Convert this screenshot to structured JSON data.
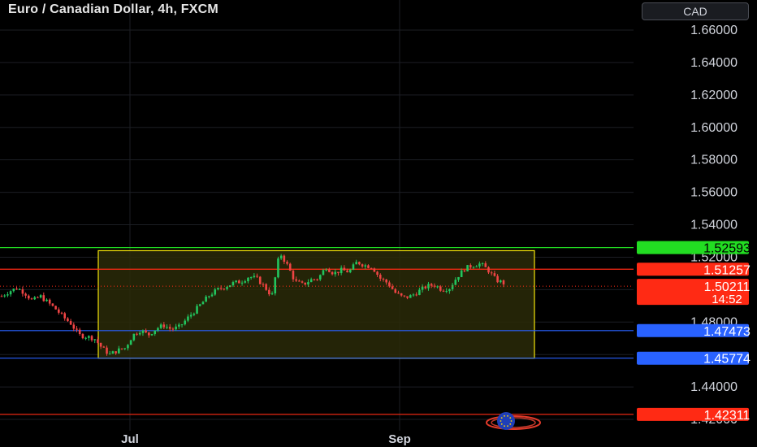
{
  "header": {
    "title": "Euro / Canadian Dollar, 4h, FXCM",
    "currency_button": "CAD"
  },
  "colors": {
    "background": "#000000",
    "grid": "#1c1e24",
    "up_candle": "#22c55e",
    "down_candle": "#ef4444",
    "box_border": "#f5e50a",
    "box_fill": "#2a2a08",
    "green_line": "#22dd22",
    "red_line": "#ff2a14",
    "blue_line": "#2962ff",
    "axis_text": "#d1d4dc"
  },
  "chart_data": {
    "type": "candlestick",
    "symbol": "EURCAD",
    "timeframe": "4h",
    "source": "FXCM",
    "ylim": [
      1.41,
      1.67
    ],
    "y_ticks": [
      "1.66000",
      "1.64000",
      "1.62000",
      "1.60000",
      "1.58000",
      "1.56000",
      "1.54000",
      "1.52000",
      "1.48000",
      "1.44000",
      "1.42000"
    ],
    "x_ticks": [
      "Jul",
      "Sep"
    ],
    "price_path": [
      1.496,
      1.499,
      1.501,
      1.498,
      1.493,
      1.496,
      1.492,
      1.488,
      1.483,
      1.479,
      1.472,
      1.471,
      1.47,
      1.464,
      1.46,
      1.4625,
      1.464,
      1.472,
      1.475,
      1.472,
      1.476,
      1.478,
      1.4755,
      1.477,
      1.482,
      1.487,
      1.492,
      1.497,
      1.5,
      1.502,
      1.504,
      1.505,
      1.508,
      1.507,
      1.502,
      1.496,
      1.523,
      1.515,
      1.505,
      1.503,
      1.506,
      1.507,
      1.514,
      1.51,
      1.512,
      1.511,
      1.517,
      1.515,
      1.514,
      1.507,
      1.504,
      1.498,
      1.495,
      1.496,
      1.499,
      1.502,
      1.503,
      1.5,
      1.501,
      1.508,
      1.513,
      1.515,
      1.516,
      1.512,
      1.506,
      1.504
    ],
    "horizontal_levels": [
      {
        "price": 1.52593,
        "label": "1.52593",
        "style": "green"
      },
      {
        "price": 1.51257,
        "label": "1.51257",
        "style": "red"
      },
      {
        "price": 1.47473,
        "label": "1.47473",
        "style": "blue"
      },
      {
        "price": 1.45774,
        "label": "1.45774",
        "style": "blue"
      },
      {
        "price": 1.42311,
        "label": "1.42311",
        "style": "red"
      }
    ],
    "last_price": {
      "price": 1.50211,
      "label": "1.50211",
      "countdown": "14:52"
    },
    "range_box": {
      "top": 1.524,
      "bottom": 1.4577
    }
  }
}
